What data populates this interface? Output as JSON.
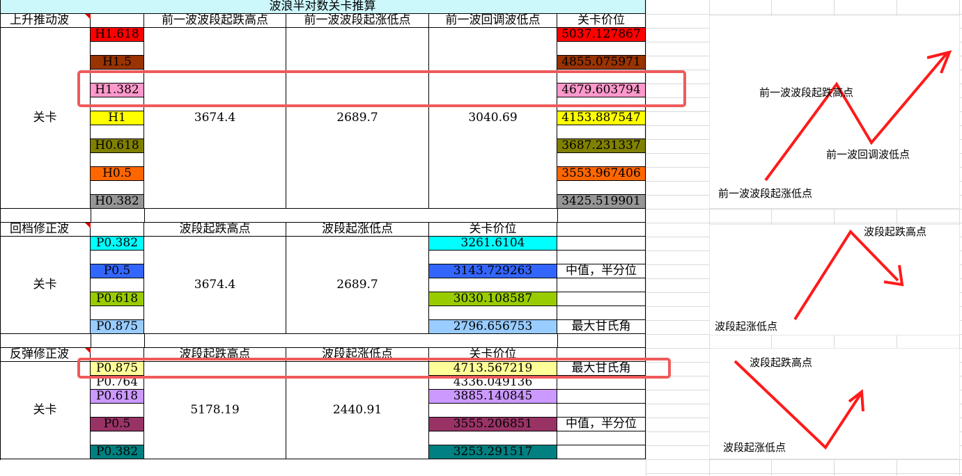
{
  "title": "波浪半对数关卡推算",
  "colors": {
    "title_bg": "#ccf7fb",
    "arrow": "#ff1a1a",
    "highlight": "#ef5a5a"
  },
  "sec1": {
    "name": "上升推动波",
    "headers": [
      "前一波波段起跌高点",
      "前一波波段起涨低点",
      "前一波回调波低点",
      "关卡价位"
    ],
    "row_label": "关卡",
    "values": [
      "3674.4",
      "2689.7",
      "3040.69"
    ],
    "levels": [
      {
        "label": "H1.618",
        "value": "5037.127867",
        "color": "#ff0000"
      },
      {
        "label": "H1.5",
        "value": "4855.075971",
        "color": "#993300"
      },
      {
        "label": "H1.382",
        "value": "4679.603794",
        "color": "#ff99cc"
      },
      {
        "label": "H1",
        "value": "4153.887547",
        "color": "#ffff00"
      },
      {
        "label": "H0.618",
        "value": "3687.231337",
        "color": "#808000"
      },
      {
        "label": "H0.5",
        "value": "3553.967406",
        "color": "#ff6600"
      },
      {
        "label": "H0.382",
        "value": "3425.519901",
        "color": "#969696"
      }
    ]
  },
  "sec2": {
    "name": "回档修正波",
    "headers": [
      "波段起跌高点",
      "波段起涨低点",
      "关卡价位"
    ],
    "row_label": "关卡",
    "values": [
      "3674.4",
      "2689.7"
    ],
    "levels": [
      {
        "label": "P0.382",
        "value": "3261.6104",
        "color": "#00ffff",
        "note": ""
      },
      {
        "label": "P0.5",
        "value": "3143.729263",
        "color": "#3366ff",
        "note": "中值，半分位"
      },
      {
        "label": "P0.618",
        "value": "3030.108587",
        "color": "#99cc00",
        "note": ""
      },
      {
        "label": "P0.875",
        "value": "2796.656753",
        "color": "#99ccff",
        "note": "最大甘氏角"
      }
    ]
  },
  "sec3": {
    "name": "反弹修正波",
    "headers": [
      "波段起跌高点",
      "波段起涨低点",
      "关卡价位"
    ],
    "row_label": "关卡",
    "values": [
      "5178.19",
      "2440.91"
    ],
    "levels": [
      {
        "label": "P0.875",
        "value": "4713.567219",
        "color": "#ffff99",
        "note": "最大甘氏角"
      },
      {
        "label": "P0.764",
        "value": "4336.049136",
        "color": "#ffffff",
        "note": ""
      },
      {
        "label": "P0.618",
        "value": "3885.140845",
        "color": "#cc99ff",
        "note": ""
      },
      {
        "label": "P0.5",
        "value": "3555.206851",
        "color": "#993366",
        "note": "中值，半分位"
      },
      {
        "label": "P0.382",
        "value": "3253.291517",
        "color": "#008080",
        "note": ""
      }
    ]
  },
  "diagram1": {
    "high": "前一波波段起跌高点",
    "pullback_low": "前一波回调波低点",
    "start_low": "前一波波段起涨低点"
  },
  "diagram2": {
    "high": "波段起跌高点",
    "low": "波段起涨低点"
  },
  "diagram3": {
    "high": "波段起跌高点",
    "low": "波段起涨低点"
  }
}
